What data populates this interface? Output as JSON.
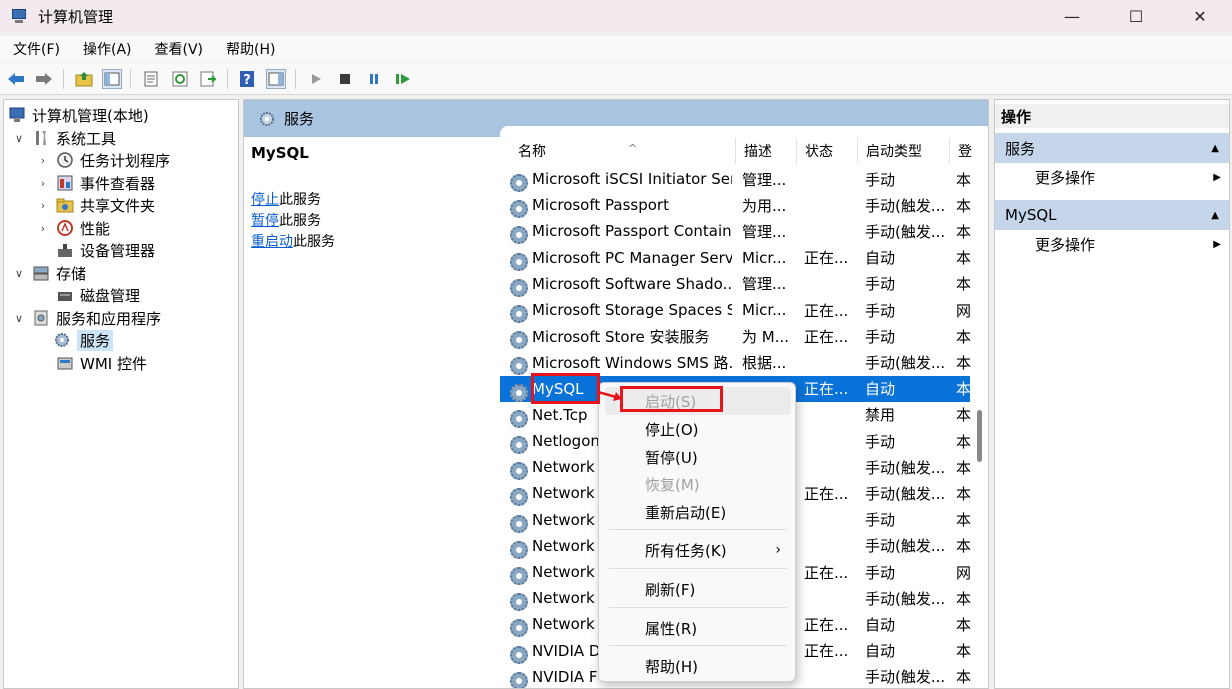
{
  "window": {
    "title": "计算机管理",
    "minimize": "—",
    "maximize": "☐",
    "close": "✕"
  },
  "menubar": [
    "文件(F)",
    "操作(A)",
    "查看(V)",
    "帮助(H)"
  ],
  "tree": {
    "root": "计算机管理(本地)",
    "system_tools": "系统工具",
    "task_scheduler": "任务计划程序",
    "event_viewer": "事件查看器",
    "shared_folders": "共享文件夹",
    "performance": "性能",
    "device_manager": "设备管理器",
    "storage": "存储",
    "disk_management": "磁盘管理",
    "services_apps": "服务和应用程序",
    "services": "服务",
    "wmi": "WMI 控件"
  },
  "center": {
    "header_title": "服务",
    "detail_name": "MySQL",
    "stop_link": "停止",
    "stop_rest": "此服务",
    "pause_link": "暂停",
    "pause_rest": "此服务",
    "restart_link": "重启动",
    "restart_rest": "此服务"
  },
  "columns": [
    "名称",
    "描述",
    "状态",
    "启动类型",
    "登"
  ],
  "rows": [
    {
      "name": "Microsoft iSCSI Initiator Ser...",
      "desc": "管理...",
      "status": "",
      "startup": "手动",
      "logon": "本"
    },
    {
      "name": "Microsoft Passport",
      "desc": "为用...",
      "status": "",
      "startup": "手动(触发...",
      "logon": "本"
    },
    {
      "name": "Microsoft Passport Container",
      "desc": "管理...",
      "status": "",
      "startup": "手动(触发...",
      "logon": "本"
    },
    {
      "name": "Microsoft PC Manager Serv...",
      "desc": "Micr...",
      "status": "正在...",
      "startup": "自动",
      "logon": "本"
    },
    {
      "name": "Microsoft Software Shado...",
      "desc": "管理...",
      "status": "",
      "startup": "手动",
      "logon": "本"
    },
    {
      "name": "Microsoft Storage Spaces S...",
      "desc": "Micr...",
      "status": "正在...",
      "startup": "手动",
      "logon": "网"
    },
    {
      "name": "Microsoft Store 安装服务",
      "desc": "为 M...",
      "status": "正在...",
      "startup": "手动",
      "logon": "本"
    },
    {
      "name": "Microsoft Windows SMS 路...",
      "desc": "根据...",
      "status": "",
      "startup": "手动(触发...",
      "logon": "本"
    },
    {
      "name": "MySQL",
      "desc": "",
      "status": "正在...",
      "startup": "自动",
      "logon": "本"
    },
    {
      "name": "Net.Tcp",
      "desc": "",
      "status": "",
      "startup": "禁用",
      "logon": "本"
    },
    {
      "name": "Netlogon",
      "desc": "",
      "status": "",
      "startup": "手动",
      "logon": "本"
    },
    {
      "name": "Network",
      "desc": "",
      "status": "",
      "startup": "手动(触发...",
      "logon": "本"
    },
    {
      "name": "Network",
      "desc": "",
      "status": "正在...",
      "startup": "手动(触发...",
      "logon": "本"
    },
    {
      "name": "Network",
      "desc": "",
      "status": "",
      "startup": "手动",
      "logon": "本"
    },
    {
      "name": "Network",
      "desc": "",
      "status": "",
      "startup": "手动(触发...",
      "logon": "本"
    },
    {
      "name": "Network",
      "desc": "",
      "status": "正在...",
      "startup": "手动",
      "logon": "网"
    },
    {
      "name": "Network",
      "desc": "",
      "status": "",
      "startup": "手动(触发...",
      "logon": "本"
    },
    {
      "name": "Network",
      "desc": "",
      "status": "正在...",
      "startup": "自动",
      "logon": "本"
    },
    {
      "name": "NVIDIA D",
      "desc": "",
      "status": "正在...",
      "startup": "自动",
      "logon": "本"
    },
    {
      "name": "NVIDIA F",
      "desc": "",
      "status": "",
      "startup": "手动(触发...",
      "logon": "本"
    }
  ],
  "actions": {
    "header": "操作",
    "section1": "服务",
    "more1": "更多操作",
    "section2": "MySQL",
    "more2": "更多操作"
  },
  "context_menu": {
    "start": "启动(S)",
    "stop": "停止(O)",
    "pause": "暂停(U)",
    "resume": "恢复(M)",
    "restart": "重新启动(E)",
    "all_tasks": "所有任务(K)",
    "refresh": "刷新(F)",
    "properties": "属性(R)",
    "help": "帮助(H)"
  },
  "colors": {
    "selection": "#0a73d9",
    "header_band": "#a9c4e0",
    "highlight_red": "#e8141b"
  }
}
